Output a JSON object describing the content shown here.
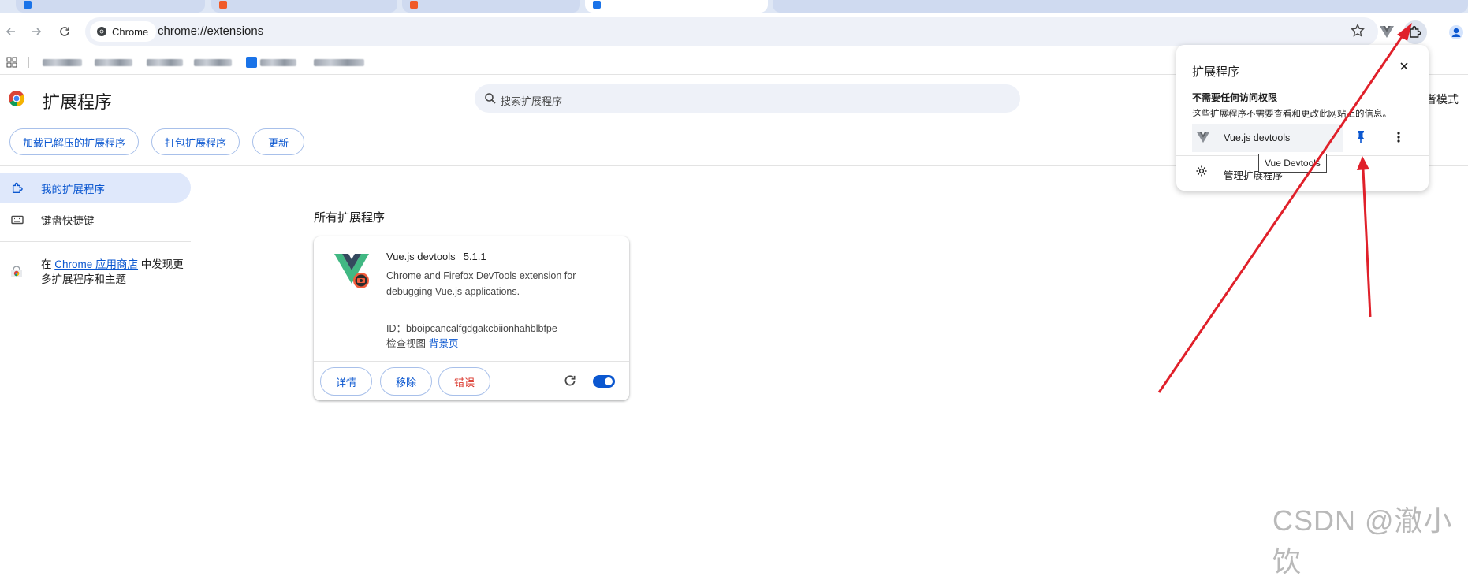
{
  "browser": {
    "chip_label": "Chrome",
    "url": "chrome://extensions",
    "tab_favicon_colors": [
      "#1a73e8",
      "#f05a28",
      "#f05a28",
      "#1a73e8"
    ]
  },
  "page": {
    "title": "扩展程序",
    "search_placeholder": "搜索扩展程序",
    "developer_mode_label": "者模式",
    "buttons": {
      "load_unpacked": "加载已解压的扩展程序",
      "pack": "打包扩展程序",
      "update": "更新"
    }
  },
  "sidebar": {
    "items": [
      {
        "label": "我的扩展程序",
        "selected": true
      },
      {
        "label": "键盘快捷键",
        "selected": false
      }
    ],
    "store_note_pre": "在 ",
    "store_link": "Chrome 应用商店",
    "store_note_post": " 中发现更多扩展程序和主题"
  },
  "main": {
    "section_title": "所有扩展程序",
    "extension": {
      "name": "Vue.js devtools",
      "version": "5.1.1",
      "description": "Chrome and Firefox DevTools extension for debugging Vue.js applications.",
      "id_text": "ID：bboipcancalfgdgakcbiionhahblbfpe",
      "inspect_label": "检查视图",
      "inspect_link": "背景页",
      "details_button": "详情",
      "remove_button": "移除",
      "errors_button": "错误",
      "enabled": true
    }
  },
  "popup": {
    "title": "扩展程序",
    "subtitle": "不需要任何访问权限",
    "description": "这些扩展程序不需要查看和更改此网站上的信息。",
    "item_name": "Vue.js devtools",
    "tooltip": "Vue Devtools",
    "manage_label": "管理扩展程序"
  },
  "colors": {
    "accent": "#0b57d0",
    "error": "#d93025",
    "annotation": "#e0202a"
  },
  "watermark": "CSDN @澈小饮"
}
